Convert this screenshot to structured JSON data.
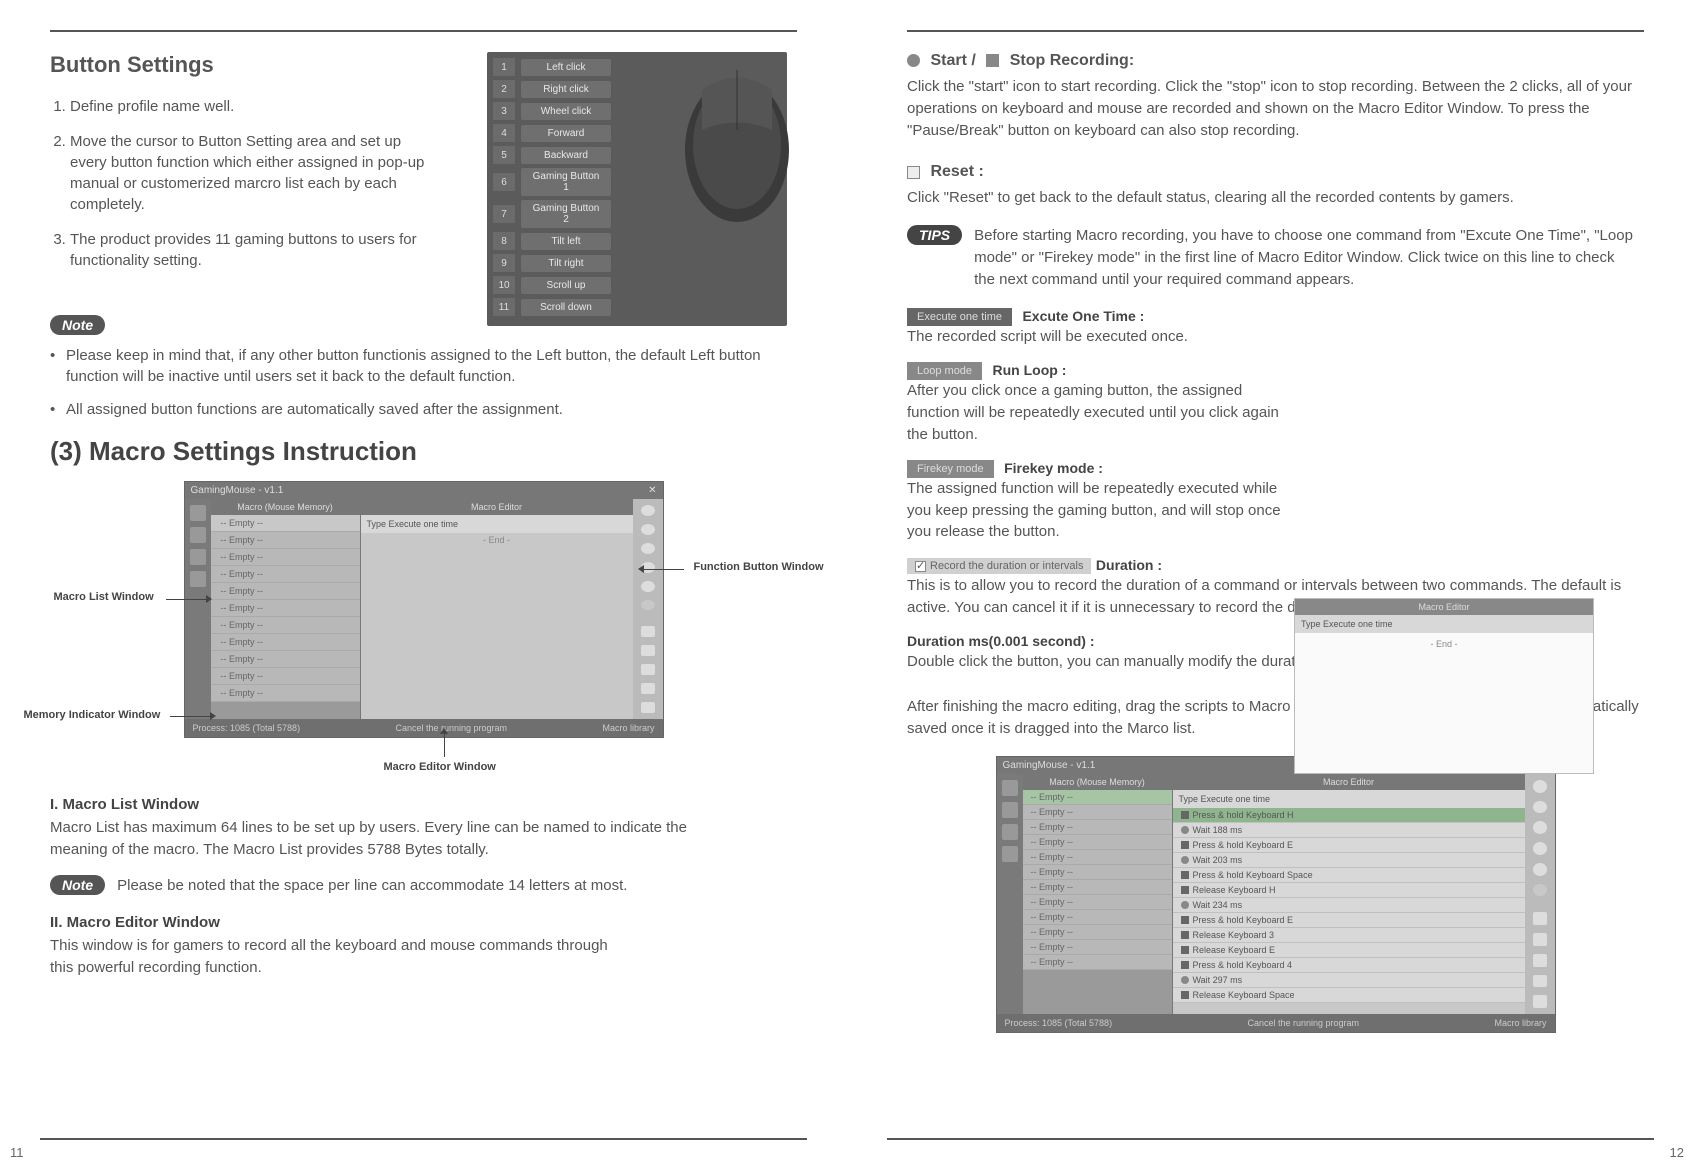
{
  "left": {
    "title": "Button Settings",
    "steps": [
      "Define profile name well.",
      "Move the cursor to Button Setting area and set up every button function which either assigned in pop-up manual or customerized marcro list each by each completely.",
      "The product provides 11 gaming buttons to users for functionality setting."
    ],
    "mouseButtons": [
      {
        "n": "1",
        "lbl": "Left click"
      },
      {
        "n": "2",
        "lbl": "Right click"
      },
      {
        "n": "3",
        "lbl": "Wheel click"
      },
      {
        "n": "4",
        "lbl": "Forward"
      },
      {
        "n": "5",
        "lbl": "Backward"
      },
      {
        "n": "6",
        "lbl": "Gaming Button 1"
      },
      {
        "n": "7",
        "lbl": "Gaming Button 2"
      },
      {
        "n": "8",
        "lbl": "Tilt left"
      },
      {
        "n": "9",
        "lbl": "Tilt right"
      },
      {
        "n": "10",
        "lbl": "Scroll up"
      },
      {
        "n": "11",
        "lbl": "Scroll down"
      }
    ],
    "noteLabel": "Note",
    "noteBullets": [
      "Please keep in mind that, if any other button functionis assigned to the Left button, the default Left button function will be inactive until users set it back to the default function.",
      "All assigned button functions are automatically saved after the assignment."
    ],
    "macroHeading": "(3) Macro Settings Instruction",
    "callouts": {
      "macroList": "Macro List Window",
      "memory": "Memory Indicator Window",
      "fn": "Function Button Window",
      "editor": "Macro Editor Window"
    },
    "fig": {
      "appTitle": "GamingMouse - v1.1",
      "listHdr": "Macro (Mouse Memory)",
      "edHdr": "Macro Editor",
      "typeRow": "Type   Execute one time",
      "empty": "-- Empty --",
      "status1": "Process: 1085 (Total 5788)",
      "status2": "Cancel the running program",
      "status3": "Macro library"
    },
    "sec1h": "I. Macro List Window",
    "sec1": "Macro List has maximum 64 lines to be set up by users. Every line can be named to indicate the meaning of the macro. The Macro List provides 5788 Bytes totally.",
    "note2": "Please be noted that the space per line can accommodate 14 letters at most.",
    "sec2h": "II. Macro Editor Window",
    "sec2": "This window is for gamers to record all the keyboard and mouse commands through this powerful recording function.",
    "pageNum": "11"
  },
  "right": {
    "startStop": {
      "start": "Start /",
      "stop": "Stop Recording:"
    },
    "startStopBody": "Click the \"start\" icon to start recording. Click the \"stop\" icon to stop recording. Between the 2 clicks, all of your operations on keyboard and mouse are recorded and shown on the Macro Editor Window. To press the \"Pause/Break\" button on keyboard can also stop recording.",
    "resetH": "Reset :",
    "resetBody": "Click \"Reset\" to get back to the default status, clearing all the recorded contents by gamers.",
    "tipsLabel": "TIPS",
    "tipsBody": "Before starting Macro recording, you have to choose one command from \"Excute One Time\", \"Loop mode\" or \"Firekey mode\" in the first line of Macro Editor Window. Click twice on this line to check the next command until your required command appears.",
    "modes": {
      "once": {
        "tag": "Execute one time",
        "h": "Excute One Time :",
        "b": "The recorded script will be executed once."
      },
      "loop": {
        "tag": "Loop mode",
        "h": "Run Loop :",
        "b": "After you click once a gaming button, the assigned function will be repeatedly executed until you click again the button."
      },
      "fire": {
        "tag": "Firekey mode",
        "h": "Firekey mode :",
        "b": "The assigned function will be repeatedly executed while you keep pressing the gaming button, and will stop once you release the button."
      },
      "dur": {
        "tag": "Record the duration or intervals",
        "h": "Duration :",
        "b": "This is to allow you to record the duration of a command or intervals between two commands. The default is active. You can cancel it if it is unnecessary to record the duration."
      },
      "durms": {
        "h": "Duration ms(0.001 second) :",
        "b": "Double click the button, you can  manually modify the duration time directly."
      }
    },
    "floatPanel": {
      "hdr": "Macro Editor",
      "type": "Type   Execute one time",
      "body": "- End -"
    },
    "afterEdit": "After finishing the macro editing, drag the scripts to Macro List Window and name it. The script is automatically saved once it is dragged into the Marco list.",
    "fig2": {
      "appTitle": "GamingMouse - v1.1",
      "listHdr": "Macro (Mouse Memory)",
      "edHdr": "Macro Editor",
      "typeRow": "Type   Execute one time",
      "rows": [
        "Press & hold Keyboard  H",
        "Wait 188 ms",
        "Press & hold Keyboard  E",
        "Wait 203 ms",
        "Press & hold Keyboard  Space",
        "Release Keyboard  H",
        "Wait 234 ms",
        "Press & hold Keyboard  E",
        "Release Keyboard  3",
        "Release Keyboard  E",
        "Press & hold Keyboard  4",
        "Wait 297 ms",
        "Release Keyboard  Space"
      ],
      "status1": "Process: 1085 (Total 5788)",
      "status2": "Cancel the running program",
      "status3": "Macro library"
    },
    "pageNum": "12"
  }
}
